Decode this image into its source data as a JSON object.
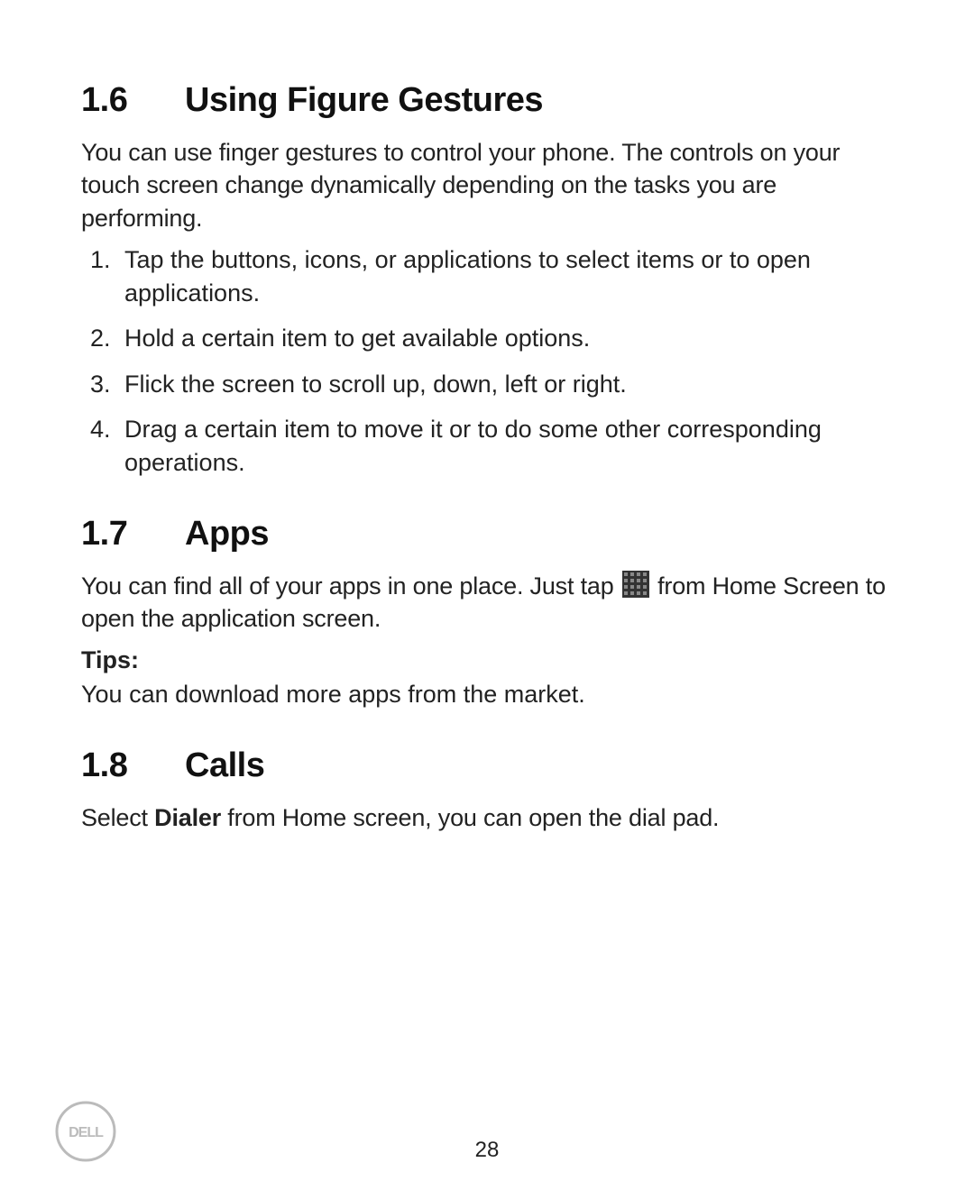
{
  "sections": {
    "s1": {
      "num": "1.6",
      "title": "Using Figure Gestures",
      "body": "You can use finger gestures to control your phone. The controls on your touch screen change dynamically depending on the tasks you are performing.",
      "steps": [
        "Tap the buttons, icons, or applications to select items or to open applications.",
        "Hold a certain item to get available options.",
        "Flick the screen to scroll up, down, left or right.",
        "Drag a certain item to move it or to do some other corresponding operations."
      ]
    },
    "s2": {
      "num": "1.7",
      "title": "Apps",
      "body_pre": "You can find all of your apps in one place. Just tap ",
      "body_post": " from Home Screen to open the application screen.",
      "tips_label": "Tips:",
      "tips_body": "You can download more apps from the market."
    },
    "s3": {
      "num": "1.8",
      "title": "Calls",
      "body_pre": "Select ",
      "body_bold": "Dialer",
      "body_post": " from Home screen, you can open the dial pad."
    }
  },
  "page_number": "28",
  "logo_alt": "Dell"
}
